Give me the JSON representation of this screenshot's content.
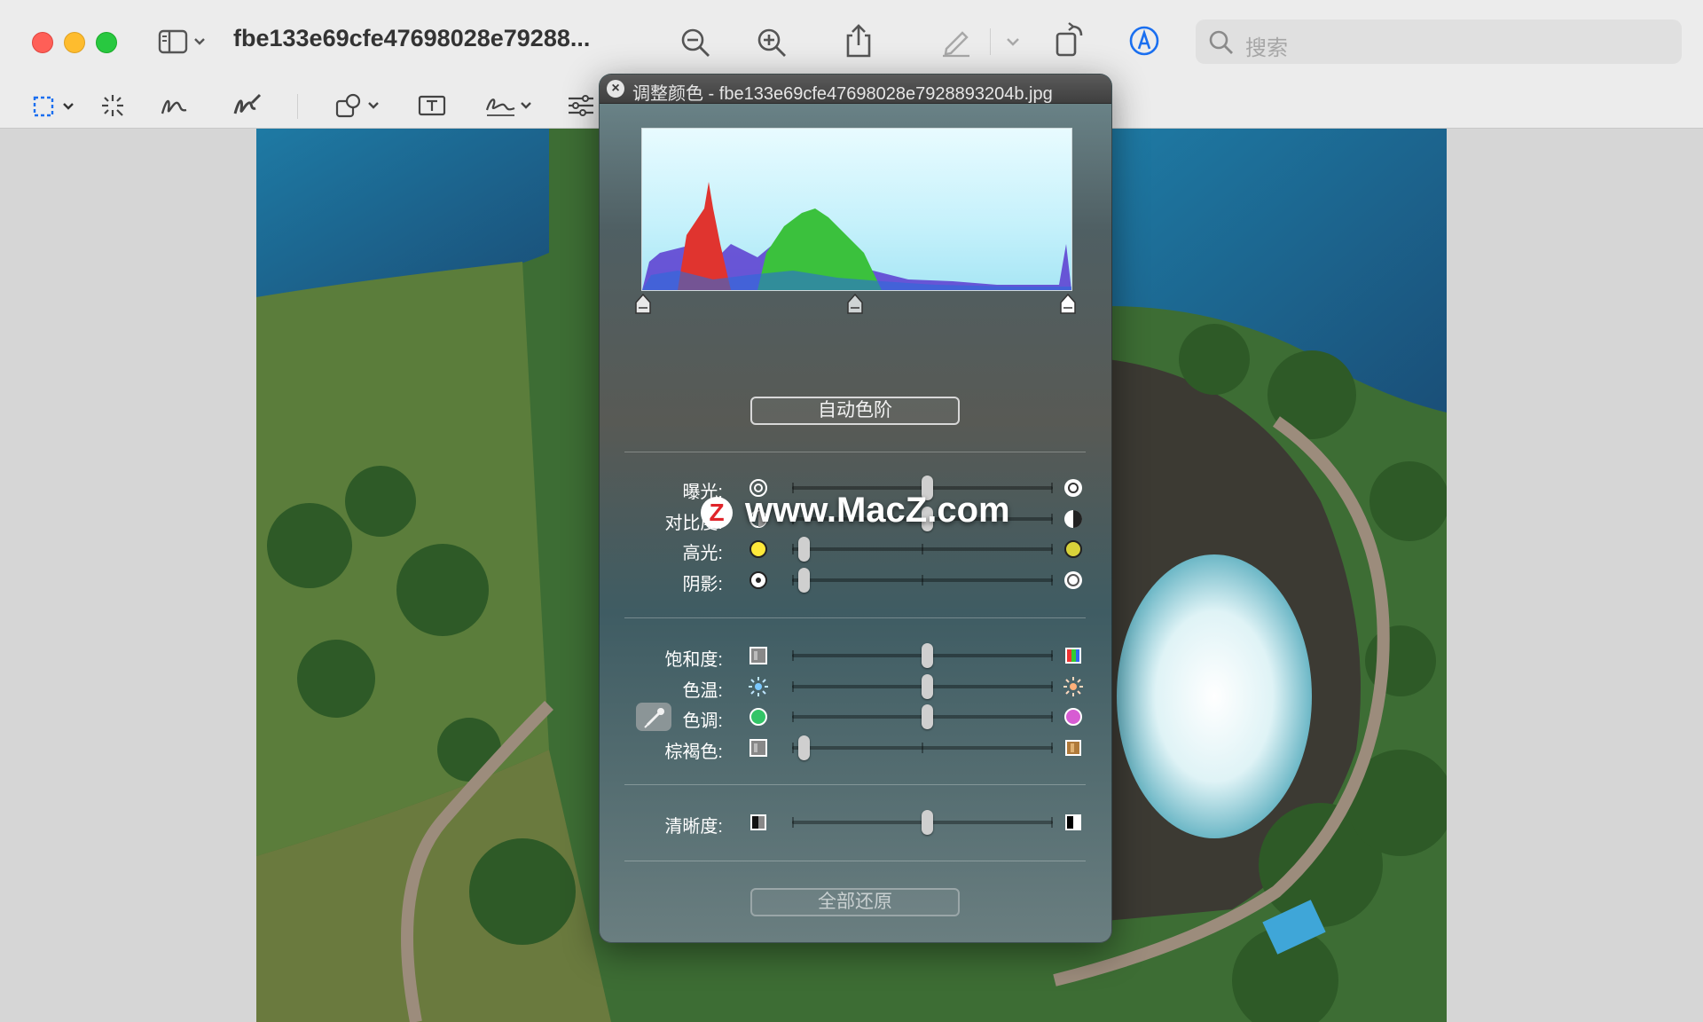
{
  "window": {
    "title": "fbe133e69cfe47698028e79288...",
    "search_placeholder": "搜索"
  },
  "toolbar": {
    "icons": [
      "sidebar-icon",
      "chevron-down-icon",
      "zoom-out-icon",
      "zoom-in-icon",
      "share-icon",
      "markup-pen-icon",
      "chevron-down-icon",
      "rotate-icon",
      "annotate-circle-icon",
      "search-icon"
    ],
    "markup_icons": [
      "rect-select-icon",
      "chevron-down-icon",
      "instant-alpha-icon",
      "sketch-icon",
      "draw-icon",
      "shapes-icon",
      "chevron-down-icon",
      "text-box-icon",
      "sign-icon",
      "chevron-down-icon",
      "adjust-color-icon"
    ]
  },
  "panel": {
    "title": "调整颜色 - fbe133e69cfe47698028e7928893204b.jpg",
    "auto_levels_label": "自动色阶",
    "reset_all_label": "全部还原",
    "sliders_group1": [
      {
        "label": "曝光:",
        "value": 0.5,
        "left_icon": "exposure-low-icon",
        "right_icon": "exposure-high-icon"
      },
      {
        "label": "对比度:",
        "value": 0.5,
        "left_icon": "contrast-low-icon",
        "right_icon": "contrast-high-icon"
      },
      {
        "label": "高光:",
        "value": 0.0,
        "left_icon": "highlight-low-icon",
        "right_icon": "highlight-high-icon"
      },
      {
        "label": "阴影:",
        "value": 0.0,
        "left_icon": "shadow-low-icon",
        "right_icon": "shadow-high-icon"
      }
    ],
    "sliders_group2": [
      {
        "label": "饱和度:",
        "value": 0.5,
        "left_icon": "saturation-low-icon",
        "right_icon": "saturation-high-icon"
      },
      {
        "label": "色温:",
        "value": 0.5,
        "left_icon": "temperature-cool-icon",
        "right_icon": "temperature-warm-icon"
      },
      {
        "label": "色调:",
        "value": 0.5,
        "left_icon": "tint-green-icon",
        "right_icon": "tint-magenta-icon"
      },
      {
        "label": "棕褐色:",
        "value": 0.0,
        "left_icon": "sepia-low-icon",
        "right_icon": "sepia-high-icon"
      }
    ],
    "sliders_group3": [
      {
        "label": "清晰度:",
        "value": 0.5,
        "left_icon": "sharpness-low-icon",
        "right_icon": "sharpness-high-icon"
      }
    ]
  },
  "watermark": {
    "badge": "Z",
    "text": "www.MacZ.com"
  },
  "colors": {
    "histogram_red": "#e0342f",
    "histogram_green": "#3bc13d",
    "histogram_blue": "#5a3bd0",
    "histogram_bg": "#c5f1fb"
  }
}
